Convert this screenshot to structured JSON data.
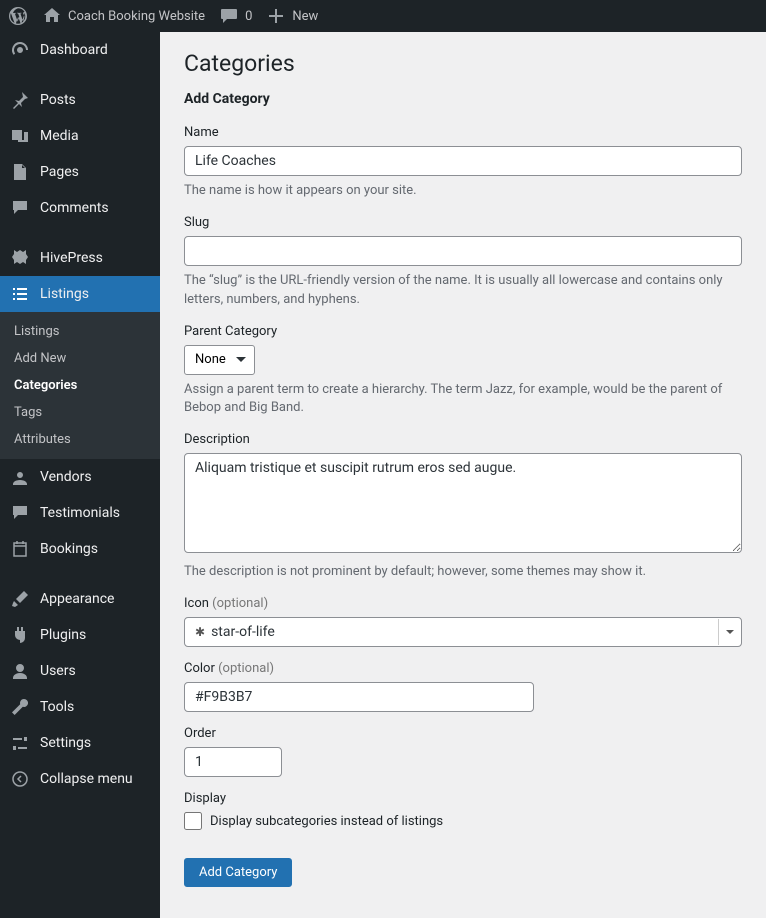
{
  "adminbar": {
    "site_title": "Coach Booking Website",
    "comments_count": "0",
    "new_label": "New"
  },
  "sidebar": {
    "dashboard": "Dashboard",
    "posts": "Posts",
    "media": "Media",
    "pages": "Pages",
    "comments": "Comments",
    "hivepress": "HivePress",
    "listings": "Listings",
    "sub": {
      "listings": "Listings",
      "add_new": "Add New",
      "categories": "Categories",
      "tags": "Tags",
      "attributes": "Attributes"
    },
    "vendors": "Vendors",
    "testimonials": "Testimonials",
    "bookings": "Bookings",
    "appearance": "Appearance",
    "plugins": "Plugins",
    "users": "Users",
    "tools": "Tools",
    "settings": "Settings",
    "collapse": "Collapse menu"
  },
  "page": {
    "title": "Categories",
    "subtitle": "Add Category",
    "name": {
      "label": "Name",
      "value": "Life Coaches",
      "help": "The name is how it appears on your site."
    },
    "slug": {
      "label": "Slug",
      "value": "",
      "help": "The “slug” is the URL-friendly version of the name. It is usually all lowercase and contains only letters, numbers, and hyphens."
    },
    "parent": {
      "label": "Parent Category",
      "selected": "None",
      "help": "Assign a parent term to create a hierarchy. The term Jazz, for example, would be the parent of Bebop and Big Band."
    },
    "description": {
      "label": "Description",
      "value": "Aliquam tristique et suscipit rutrum eros sed augue.",
      "help": "The description is not prominent by default; however, some themes may show it."
    },
    "icon": {
      "label": "Icon",
      "optional": "(optional)",
      "selected_label": "star-of-life"
    },
    "color": {
      "label": "Color",
      "optional": "(optional)",
      "value": "#F9B3B7"
    },
    "order": {
      "label": "Order",
      "value": "1"
    },
    "display": {
      "label": "Display",
      "checkbox_label": "Display subcategories instead of listings"
    },
    "submit": "Add Category"
  }
}
